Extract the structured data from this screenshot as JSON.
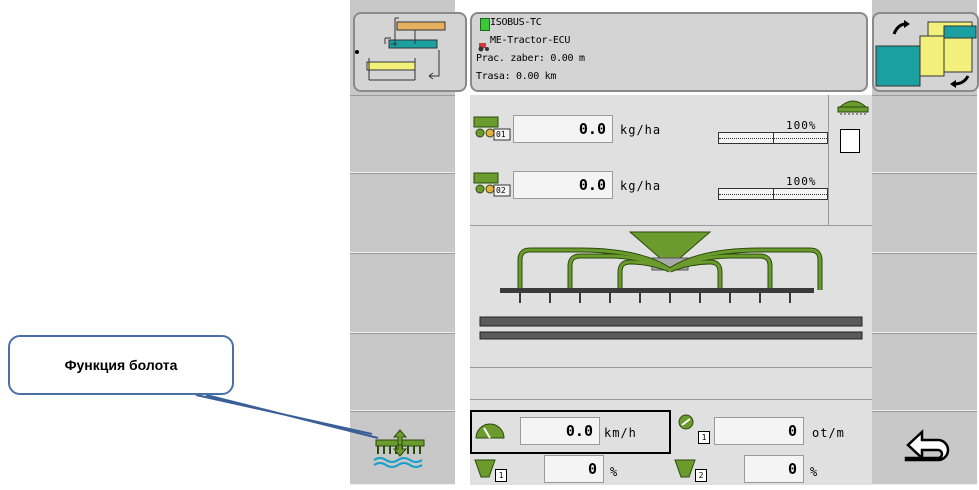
{
  "info": {
    "line1": "ISOBUS-TC",
    "line2": "ME-Tractor-ECU",
    "line3": "Prac. zaber: 0.00  m",
    "line4": "Trasa: 0.00  km"
  },
  "meter1": {
    "index": "01",
    "value": "0.0",
    "unit": "kg/ha",
    "percent_label": "100%",
    "level": 1.0
  },
  "meter2": {
    "index": "02",
    "value": "0.0",
    "unit": "kg/ha",
    "percent_label": "100%",
    "level": 1.0
  },
  "speed": {
    "value": "0.0",
    "unit": "km/h"
  },
  "rpm": {
    "index": "1",
    "value": "0",
    "unit": "ot/m"
  },
  "tank1": {
    "index": "1",
    "value": "0",
    "unit": "%"
  },
  "tank2": {
    "index": "2",
    "value": "0",
    "unit": "%"
  },
  "callout": {
    "label": "Функция болота"
  },
  "colors": {
    "green": "#6a9b2c",
    "dark_green": "#3e6b12",
    "teal": "#1a9a8a",
    "yellow": "#f2f07a"
  }
}
